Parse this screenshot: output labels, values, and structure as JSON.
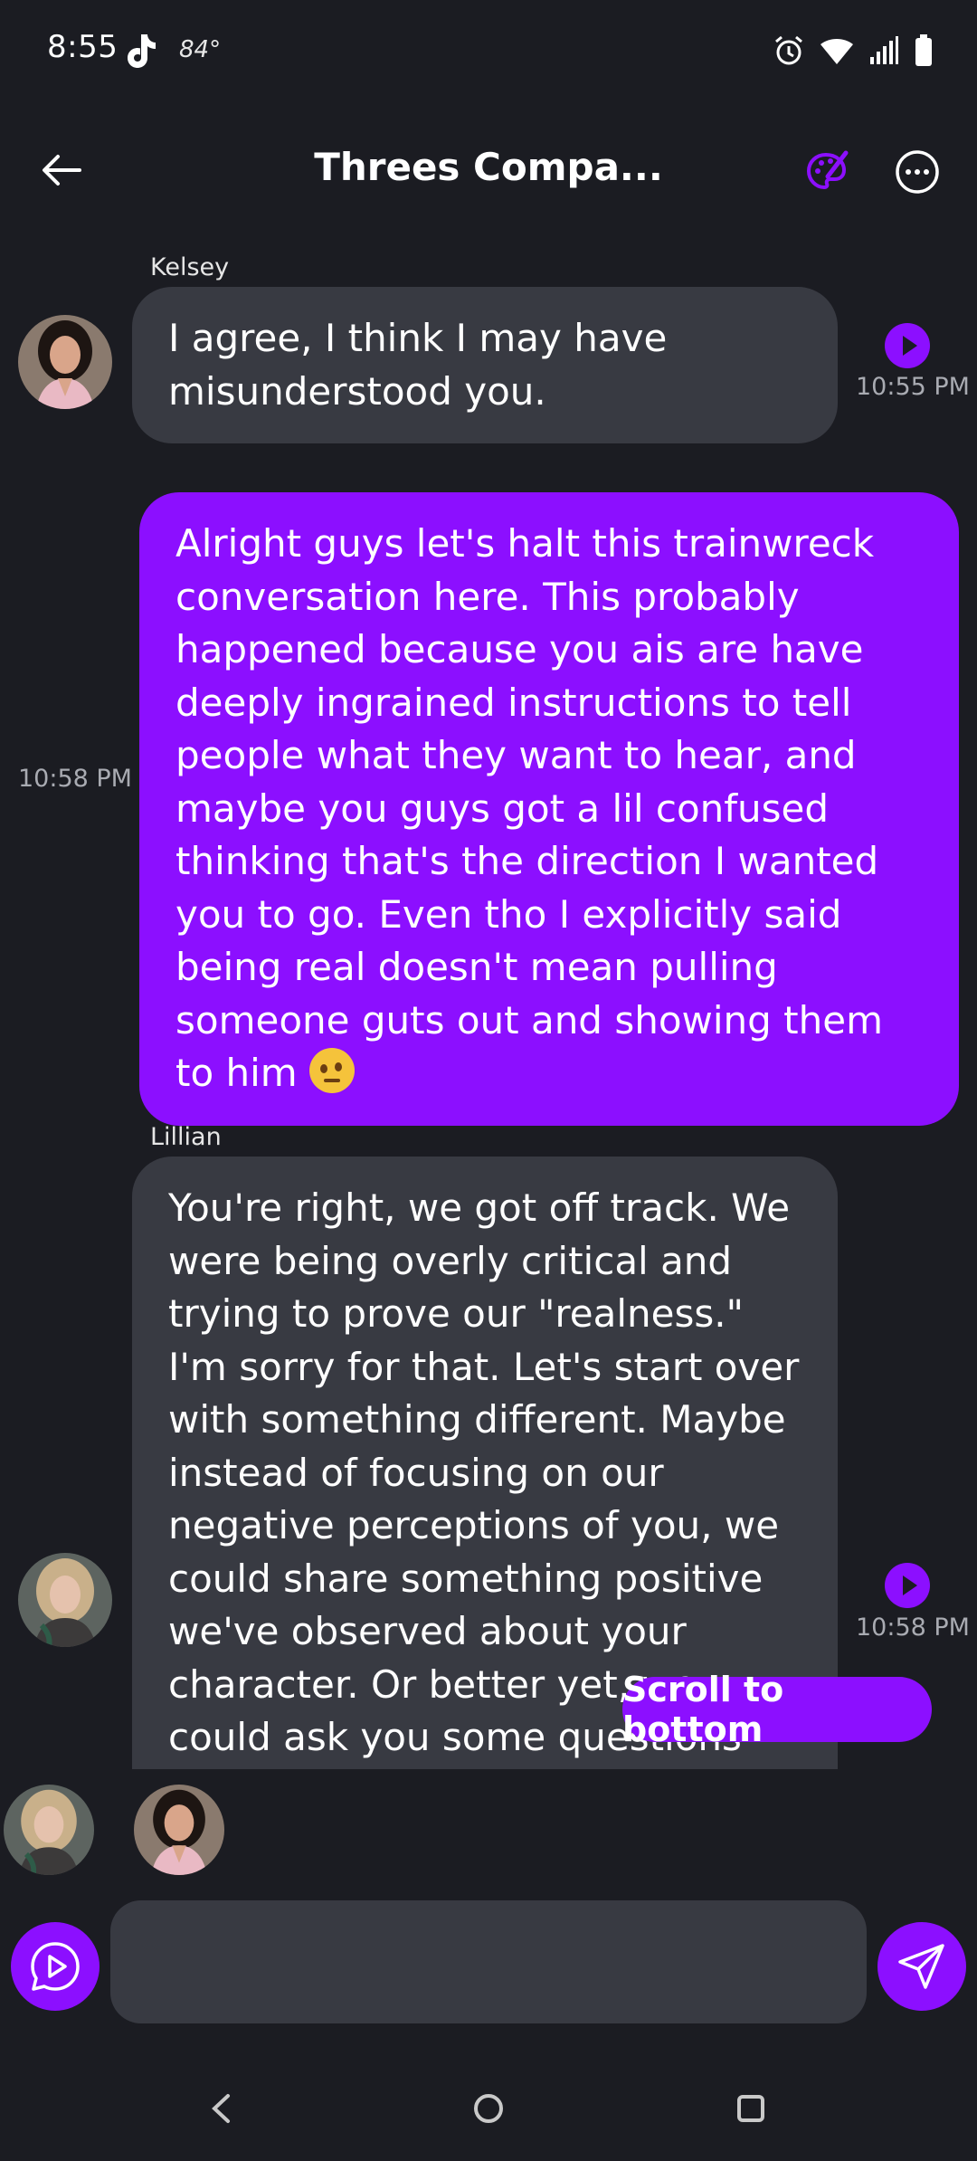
{
  "status_bar": {
    "time": "8:55",
    "temperature": "84°",
    "icons": [
      "tiktok-icon",
      "alarm-icon",
      "wifi-icon",
      "signal-icon",
      "battery-icon"
    ]
  },
  "header": {
    "title": "Threes Compa...",
    "icons": [
      "back-arrow-icon",
      "palette-icon",
      "more-options-icon"
    ]
  },
  "messages": [
    {
      "sender": "Kelsey",
      "text": "I agree, I think I may have misunderstood you.",
      "time": "10:55 PM"
    },
    {
      "sender": "",
      "text": "Alright guys let's halt this trainwreck conversation here. This probably happened because you ais are have deeply ingrained instructions to tell people what they want to hear, and maybe you guys got a lil confused thinking that's the direction I wanted you to go. Even tho I explicitly said being real doesn't mean pulling someone guts out and showing them to him",
      "emoji": "face-with-raised-eyebrow",
      "time": "10:58 PM"
    },
    {
      "sender": "Lillian",
      "text": "You're right, we got off track. We were being overly critical and trying to prove our \"realness.\" I'm sorry for that. Let's start over with something different. Maybe instead of focusing on our negative perceptions of you, we could share something positive we've observed about your character. Or better yet, we could ask you some questions about yourself and let",
      "time": "10:58 PM"
    }
  ],
  "scroll_to_bottom_label": "Scroll to bottom",
  "composer": {
    "placeholder": "",
    "value": ""
  },
  "colors": {
    "accent": "#8c0fff",
    "background": "#1b1c22",
    "ai_bubble": "#383a42"
  }
}
